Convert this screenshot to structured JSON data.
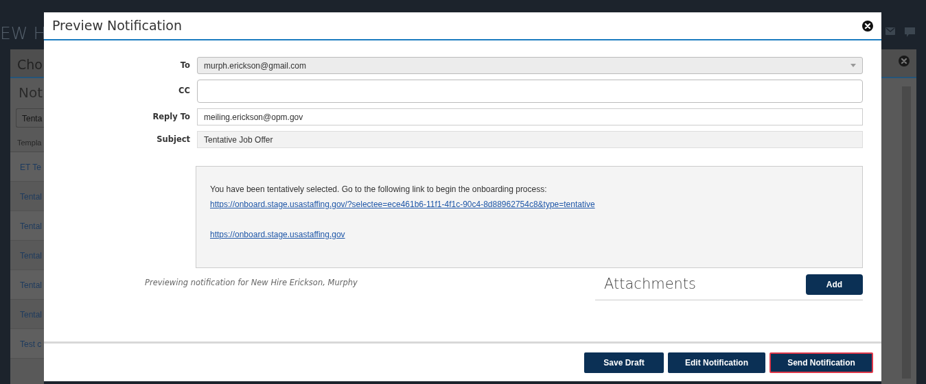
{
  "background": {
    "header": "EW H",
    "panel_title": "Cho",
    "section_title": "Not",
    "search": {
      "value": "Tenta"
    },
    "column": "Templa",
    "rows": [
      "ET Te",
      "Tental",
      "Tental",
      "Tental",
      "Tental",
      "Tental",
      "Test c"
    ]
  },
  "modal": {
    "title": "Preview Notification",
    "fields": [
      {
        "label": "To",
        "kind": "select",
        "value": "murph.erickson@gmail.com"
      },
      {
        "label": "CC",
        "kind": "input"
      },
      {
        "label": "Reply To",
        "kind": "input",
        "value": "meiling.erickson@opm.gov"
      },
      {
        "label": "Subject",
        "kind": "readonly",
        "value": "Tentative Job Offer"
      }
    ],
    "message": [
      {
        "text": "You have been tentatively selected. Go to the following link to begin the onboarding process:",
        "link": "https://onboard.stage.usastaffing.gov/?selectee=ece461b6-11f1-4f1c-90c4-8d88962754c8&type=tentative"
      },
      {
        "link": "https://onboard.stage.usastaffing.gov"
      }
    ],
    "footnote": "Previewing notification for New Hire Erickson, Murphy",
    "attachments": {
      "title": "Attachments",
      "button": "Add"
    },
    "buttons": [
      {
        "label": "Save Draft",
        "focused": false
      },
      {
        "label": "Edit Notification",
        "focused": false
      },
      {
        "label": "Send Notification",
        "focused": true
      }
    ]
  }
}
